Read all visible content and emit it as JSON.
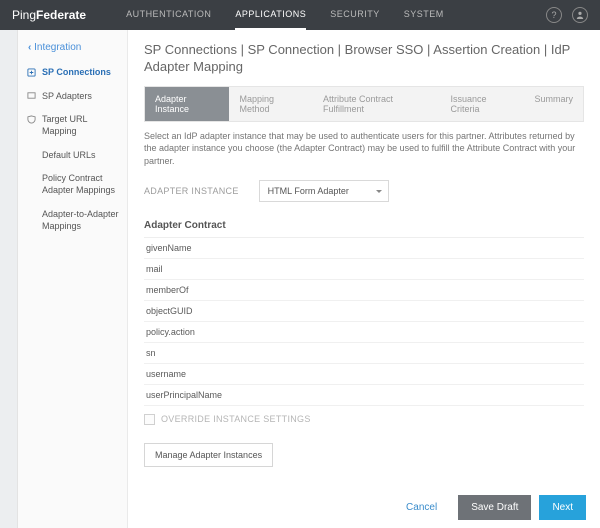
{
  "brand": {
    "a": "Ping",
    "b": "Federate"
  },
  "nav": {
    "items": [
      "AUTHENTICATION",
      "APPLICATIONS",
      "SECURITY",
      "SYSTEM"
    ],
    "activeIndex": 1
  },
  "sidebar": {
    "back": "Integration",
    "items": [
      {
        "label": "SP Connections",
        "active": true
      },
      {
        "label": "SP Adapters"
      },
      {
        "label": "Target URL Mapping"
      },
      {
        "label": "Default URLs"
      },
      {
        "label": "Policy Contract Adapter Mappings"
      },
      {
        "label": "Adapter-to-Adapter Mappings"
      }
    ]
  },
  "breadcrumb": "SP Connections | SP Connection | Browser SSO | Assertion Creation | IdP Adapter Mapping",
  "tabs": {
    "items": [
      "Adapter Instance",
      "Mapping Method",
      "Attribute Contract Fulfillment",
      "Issuance Criteria",
      "Summary"
    ],
    "activeIndex": 0
  },
  "helptext": "Select an IdP adapter instance that may be used to authenticate users for this partner. Attributes returned by the adapter instance you choose (the Adapter Contract) may be used to fulfill the Attribute Contract with your partner.",
  "adapterInstance": {
    "label": "ADAPTER INSTANCE",
    "value": "HTML Form Adapter"
  },
  "contract": {
    "title": "Adapter Contract",
    "attrs": [
      "givenName",
      "mail",
      "memberOf",
      "objectGUID",
      "policy.action",
      "sn",
      "username",
      "userPrincipalName"
    ]
  },
  "override": {
    "label": "OVERRIDE INSTANCE SETTINGS",
    "checked": false
  },
  "buttons": {
    "manage": "Manage Adapter Instances",
    "cancel": "Cancel",
    "draft": "Save Draft",
    "next": "Next"
  }
}
